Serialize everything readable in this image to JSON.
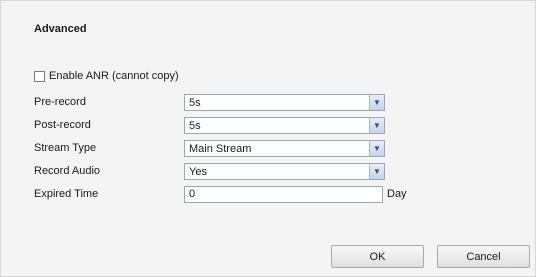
{
  "section_title": "Advanced",
  "anr": {
    "label": "Enable ANR (cannot copy)",
    "checked": false
  },
  "fields": {
    "pre_record": {
      "label": "Pre-record",
      "value": "5s"
    },
    "post_record": {
      "label": "Post-record",
      "value": "5s"
    },
    "stream_type": {
      "label": "Stream Type",
      "value": "Main Stream"
    },
    "record_audio": {
      "label": "Record Audio",
      "value": "Yes"
    },
    "expired_time": {
      "label": "Expired Time",
      "value": "0",
      "unit": "Day"
    }
  },
  "buttons": {
    "ok": "OK",
    "cancel": "Cancel"
  },
  "icons": {
    "dropdown": "chevron-down-icon"
  }
}
